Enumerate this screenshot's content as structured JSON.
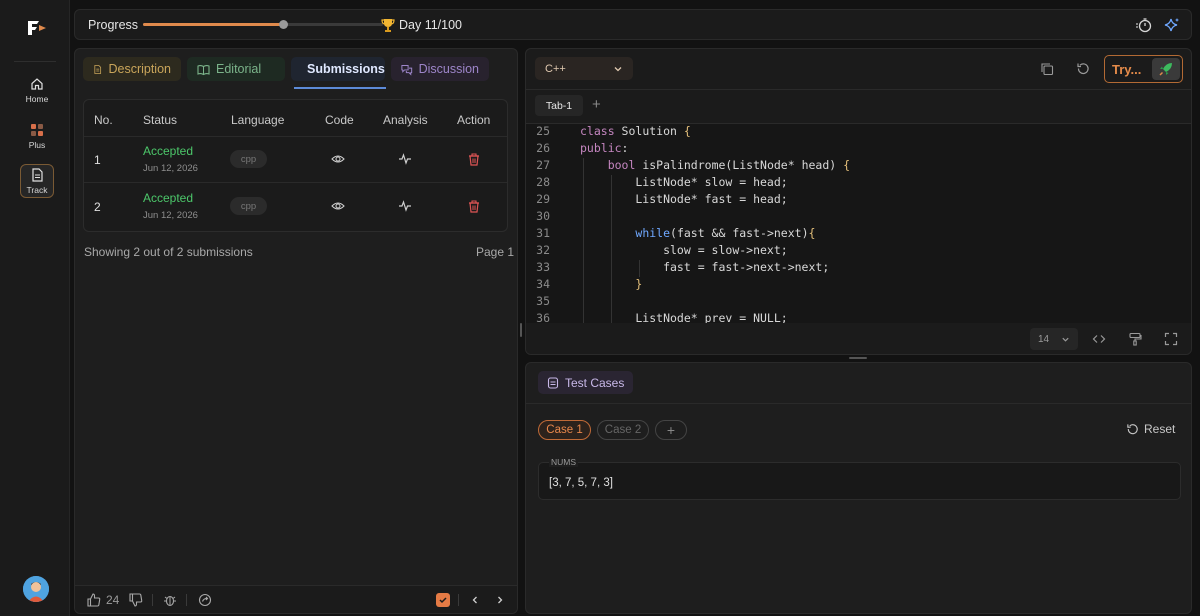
{
  "nav": {
    "items": [
      {
        "label": "Home",
        "icon": "home-icon"
      },
      {
        "label": "Plus",
        "icon": "plus-grid-icon"
      },
      {
        "label": "Track",
        "icon": "document-icon"
      }
    ]
  },
  "header": {
    "progress_label": "Progress",
    "progress_fraction": 0.11,
    "day_label": "Day 11/100"
  },
  "problem": {
    "tabs": [
      "Description",
      "Editorial",
      "Submissions",
      "Discussion"
    ],
    "active_tab": "Submissions",
    "table": {
      "columns": [
        "No.",
        "Status",
        "Language",
        "Code",
        "Analysis",
        "Action"
      ],
      "rows": [
        {
          "no": "1",
          "status": "Accepted",
          "date": "Jun 12, 2026",
          "language": "cpp"
        },
        {
          "no": "2",
          "status": "Accepted",
          "date": "Jun 12, 2026",
          "language": "cpp"
        }
      ]
    },
    "summary": "Showing 2 out of 2 submissions",
    "page": "Page 1",
    "likes": "24"
  },
  "editor": {
    "language": "C++",
    "try_label": "Try...",
    "tab_name": "Tab-1",
    "font_size": "14",
    "lines": [
      {
        "n": "25",
        "code": "class Solution {"
      },
      {
        "n": "26",
        "code": "public:"
      },
      {
        "n": "27",
        "code": "    bool isPalindrome(ListNode* head) {"
      },
      {
        "n": "28",
        "code": "        ListNode* slow = head;"
      },
      {
        "n": "29",
        "code": "        ListNode* fast = head;"
      },
      {
        "n": "30",
        "code": ""
      },
      {
        "n": "31",
        "code": "        while(fast && fast->next){"
      },
      {
        "n": "32",
        "code": "            slow = slow->next;"
      },
      {
        "n": "33",
        "code": "            fast = fast->next->next;"
      },
      {
        "n": "34",
        "code": "        }"
      },
      {
        "n": "35",
        "code": ""
      },
      {
        "n": "36",
        "code": "        ListNode* prev = NULL;"
      }
    ]
  },
  "tests": {
    "title": "Test Cases",
    "cases": [
      "Case 1",
      "Case 2"
    ],
    "active_case": "Case 1",
    "reset_label": "Reset",
    "input_label": "NUMS",
    "input_value": "[3, 7, 5, 7, 3]"
  },
  "colors": {
    "accent": "#e08a4c",
    "accepted": "#4cc76a",
    "delete": "#e05555"
  }
}
